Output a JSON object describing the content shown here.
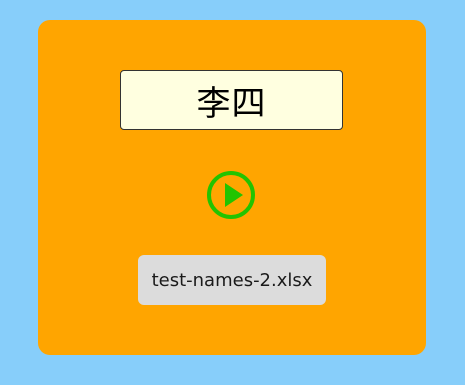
{
  "display": {
    "name": "李四"
  },
  "controls": {
    "play_icon": "play-circle-icon"
  },
  "file": {
    "label": "test-names-2.xlsx"
  },
  "colors": {
    "background": "#87cefa",
    "card": "#ffa500",
    "name_box": "#ffffe0",
    "play": "#22c400",
    "file_chip": "#dcdcdc"
  }
}
